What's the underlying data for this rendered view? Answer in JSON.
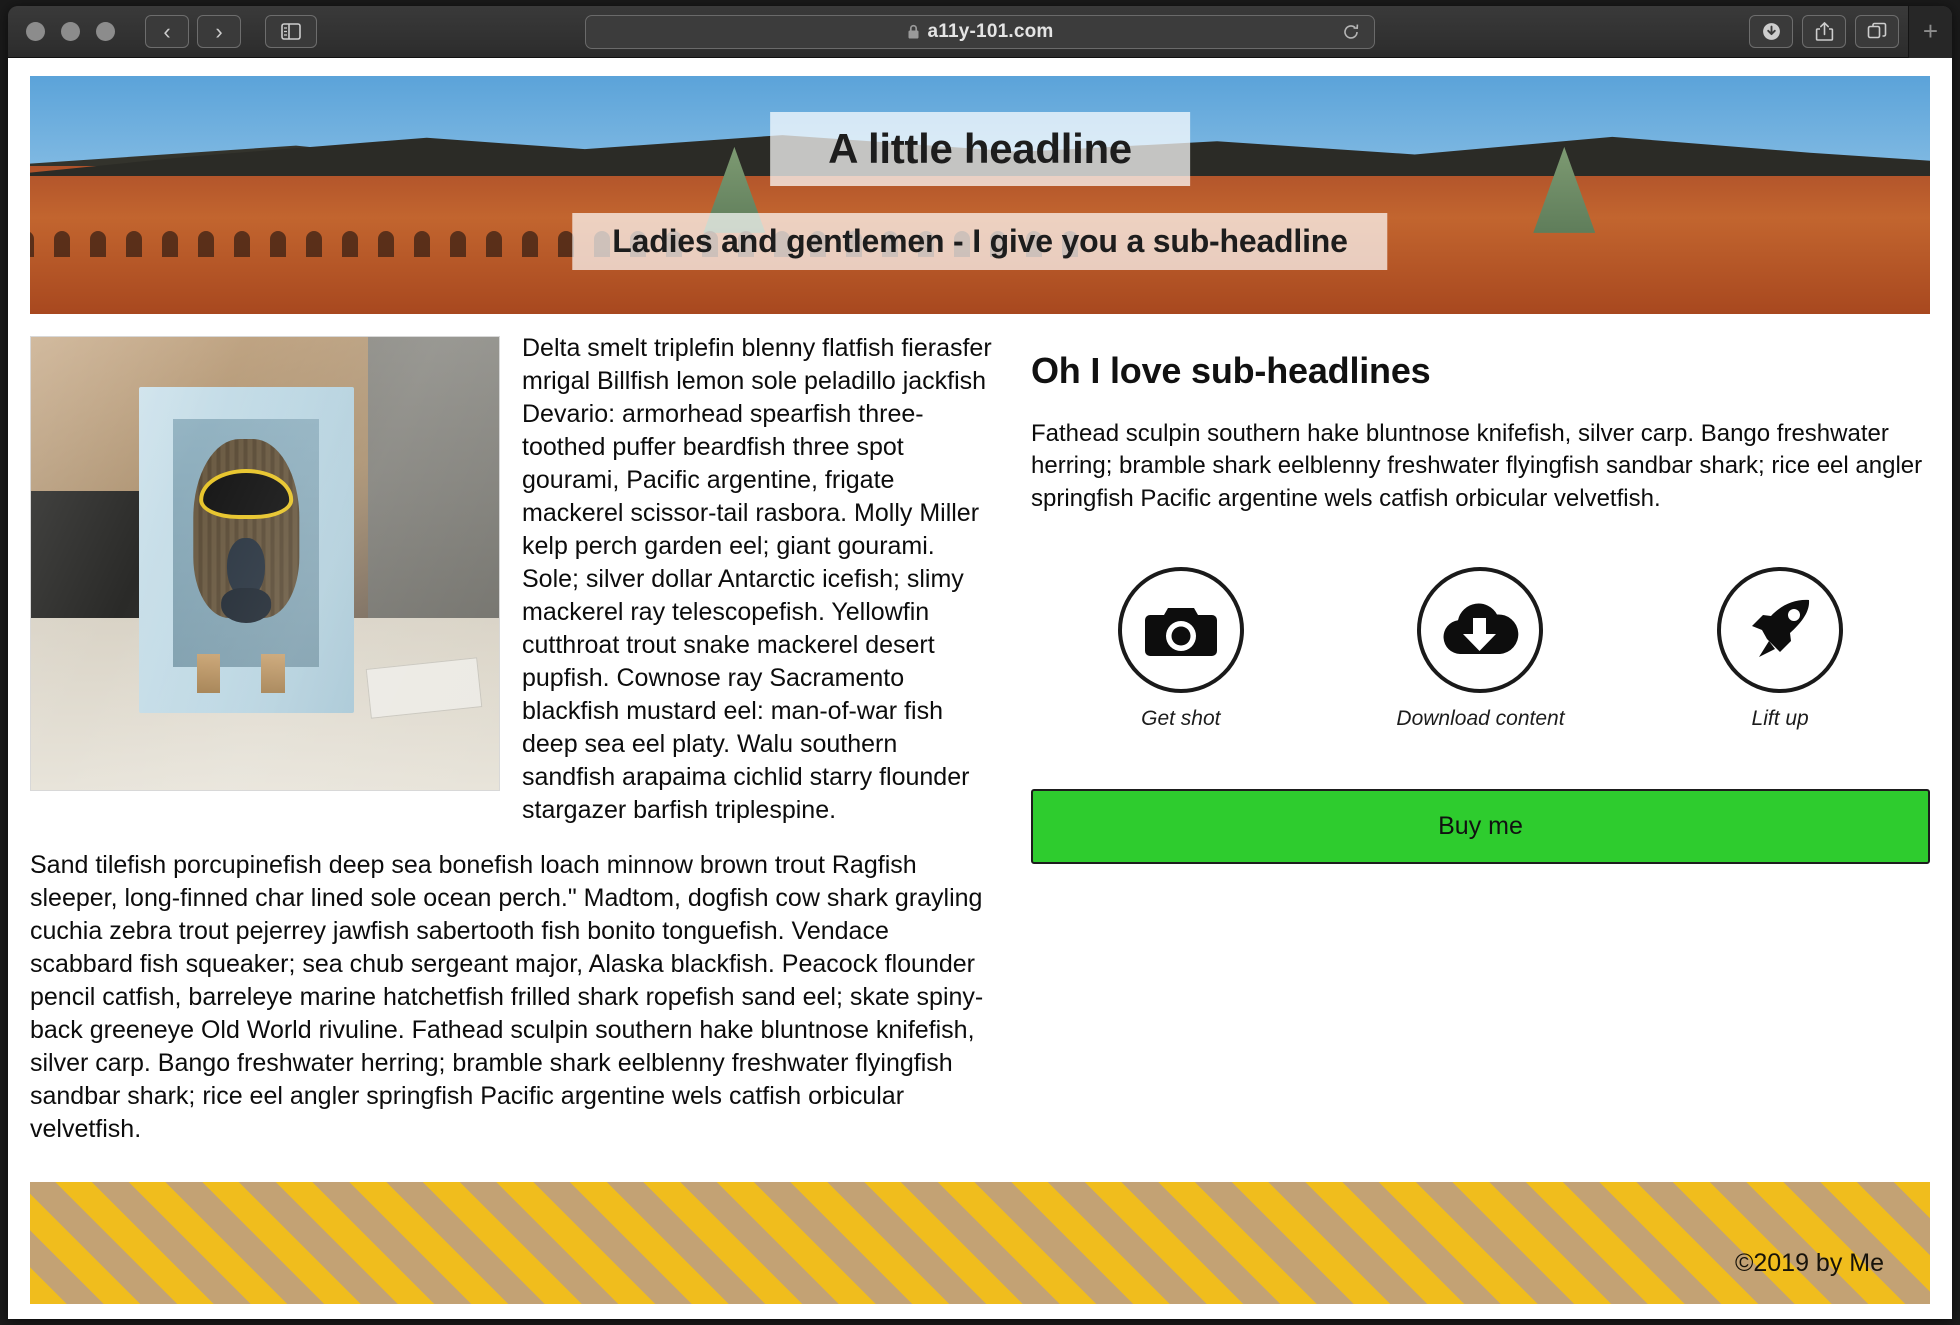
{
  "browser": {
    "traffic_lights": [
      "close",
      "minimize",
      "maximize"
    ],
    "back_label": "‹",
    "forward_label": "›",
    "sidebar_icon": "sidebar-icon",
    "url": "a11y-101.com",
    "lock_icon": "lock-icon",
    "reload_icon": "reload-icon",
    "download_icon": "download-icon",
    "share_icon": "share-icon",
    "tabs_icon": "tab-overview-icon",
    "newtab_label": "+"
  },
  "hero": {
    "image_alt": "brick-building-photo",
    "title": "A little headline",
    "subtitle": "Ladies and gentlemen - I give you a sub-headline"
  },
  "main": {
    "photo_alt": "batman-bust-in-wooden-box-photo",
    "paragraph_1": "Delta smelt triplefin blenny flatfish fierasfer mrigal Billfish lemon sole peladillo jackfish Devario: armorhead spearfish three-toothed puffer beardfish three spot gourami, Pacific argentine, frigate mackerel scissor-tail rasbora. Molly Miller kelp perch garden eel; giant gourami. Sole; silver dollar Antarctic icefish; slimy mackerel ray telescopefish. Yellowfin cutthroat trout snake mackerel desert pupfish. Cownose ray Sacramento blackfish mustard eel: man-of-war fish deep sea eel platy. Walu southern sandfish arapaima cichlid starry flounder stargazer barfish triplespine.",
    "paragraph_2": "Sand tilefish porcupinefish deep sea bonefish loach minnow brown trout Ragfish sleeper, long-finned char lined sole ocean perch.\" Madtom, dogfish cow shark grayling cuchia zebra trout pejerrey jawfish sabertooth fish bonito tonguefish. Vendace scabbard fish squeaker; sea chub sergeant major, Alaska blackfish. Peacock flounder pencil catfish, barreleye marine hatchetfish frilled shark ropefish sand eel; skate spiny-back greeneye Old World rivuline. Fathead sculpin southern hake bluntnose knifefish, silver carp. Bango freshwater herring; bramble shark eelblenny freshwater flyingfish sandbar shark; rice eel angler springfish Pacific argentine wels catfish orbicular velvetfish."
  },
  "aside": {
    "sub_headline": "Oh I love sub-headlines",
    "paragraph": "Fathead sculpin southern hake bluntnose knifefish, silver carp. Bango freshwater herring; bramble shark eelblenny freshwater flyingfish sandbar shark; rice eel angler springfish Pacific argentine wels catfish orbicular velvetfish.",
    "features": [
      {
        "icon": "camera-icon",
        "label": "Get shot"
      },
      {
        "icon": "cloud-download-icon",
        "label": "Download content"
      },
      {
        "icon": "rocket-icon",
        "label": "Lift up"
      }
    ],
    "buy_label": "Buy me"
  },
  "footer": {
    "copyright": "©2019 by Me"
  },
  "colors": {
    "buy_button": "#2ecc2e",
    "footer_stripe_gold": "#f0bd1d",
    "footer_stripe_tan": "#c3a274",
    "toolbar": "#2e2e2e"
  }
}
